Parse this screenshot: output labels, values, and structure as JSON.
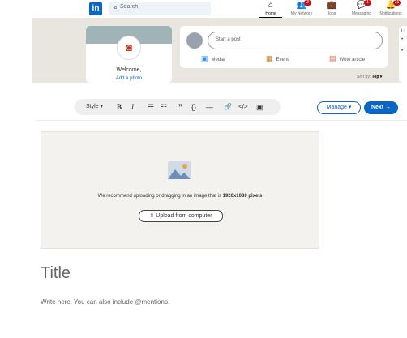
{
  "topbar": {
    "logo": "in",
    "search_placeholder": "Search",
    "nav": [
      {
        "label": "Home",
        "icon": "home-icon",
        "glyph": "⌂",
        "badge": ""
      },
      {
        "label": "My Network",
        "icon": "network-icon",
        "glyph": "👥",
        "badge": "3"
      },
      {
        "label": "Jobs",
        "icon": "briefcase-icon",
        "glyph": "💼",
        "badge": ""
      },
      {
        "label": "Messaging",
        "icon": "messaging-icon",
        "glyph": "💬",
        "badge": "1"
      },
      {
        "label": "Notifications",
        "icon": "bell-icon",
        "glyph": "🔔",
        "badge": "21"
      }
    ]
  },
  "feed": {
    "welcome": "Welcome,",
    "add_photo": "Add a photo",
    "start_post": "Start a post",
    "actions": {
      "media": "Media",
      "event": "Event",
      "article": "Write article"
    },
    "sort_label": "Sort by:",
    "sort_value": "Top ▾",
    "right_title": "Li",
    "right_bullets": [
      "•",
      "•"
    ]
  },
  "editor": {
    "toolbar": {
      "style": "Style ▾",
      "bold": "B",
      "italic": "I",
      "bullet_list": "☰",
      "numbered_list": "☷",
      "quote": "❞",
      "code": "{}",
      "divider": "—",
      "link": "🔗",
      "embed": "</>",
      "image": "▣"
    },
    "manage": "Manage ▾",
    "next": "Next →",
    "cover": {
      "recommend": "We recommend uploading or dragging in an image that is",
      "size": "1920x1080 pixels",
      "upload": "Upload from computer"
    },
    "title_placeholder": "Title",
    "body_placeholder": "Write here. You can also include @mentions."
  }
}
